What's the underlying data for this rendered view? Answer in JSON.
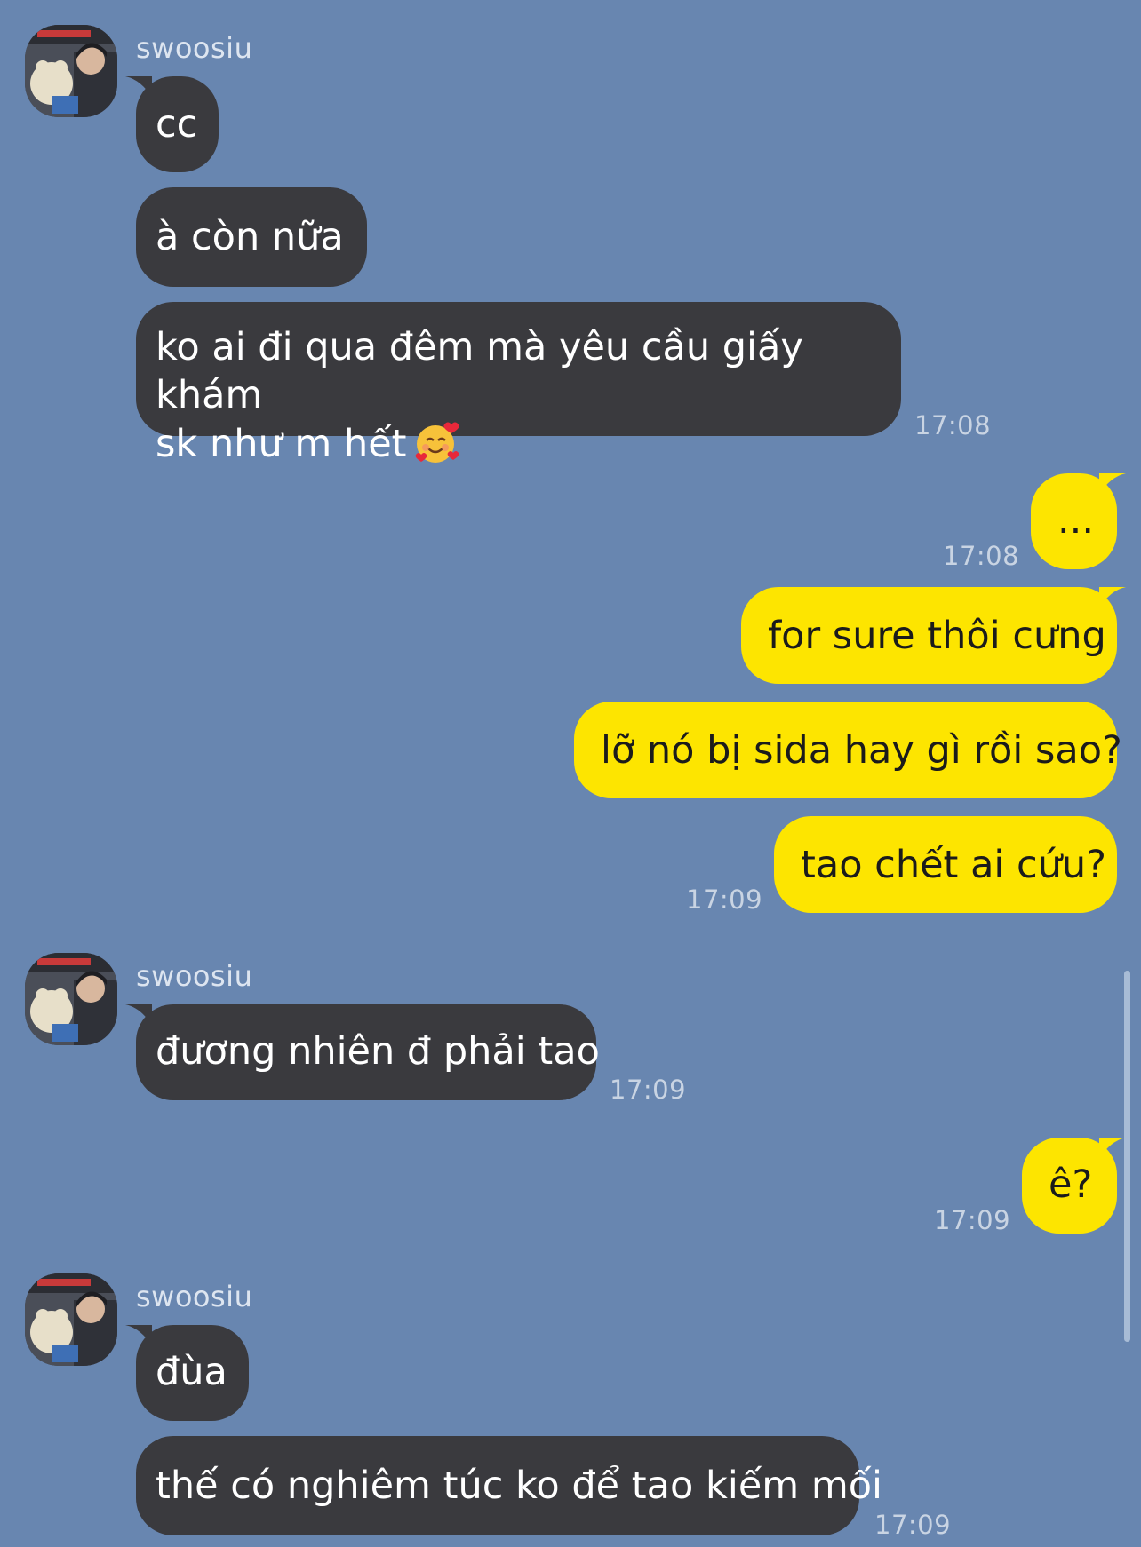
{
  "contact": {
    "name": "swoosiu"
  },
  "messages": [
    {
      "from": "them",
      "text": "cc"
    },
    {
      "from": "them",
      "text": "à còn nữa"
    },
    {
      "from": "them",
      "line1": "ko ai đi qua đêm mà yêu cầu giấy khám",
      "line2": "sk như m hết",
      "emoji": "smiling-face-with-hearts",
      "time": "17:08"
    },
    {
      "from": "me",
      "text": "...",
      "time": "17:08"
    },
    {
      "from": "me",
      "text": "for sure thôi cưng"
    },
    {
      "from": "me",
      "text": "lỡ nó bị sida hay gì rồi sao?"
    },
    {
      "from": "me",
      "text": "tao chết ai cứu?",
      "time": "17:09"
    },
    {
      "from": "them",
      "text": "đương nhiên đ phải tao",
      "time": "17:09"
    },
    {
      "from": "me",
      "text": "ê?",
      "time": "17:09"
    },
    {
      "from": "them",
      "text": "đùa"
    },
    {
      "from": "them",
      "text": "thế có nghiêm túc ko để tao kiếm mối",
      "time": "17:09"
    }
  ],
  "colors": {
    "background": "#6886b0",
    "received_bubble": "#3a3a3e",
    "sent_bubble": "#fde500"
  }
}
